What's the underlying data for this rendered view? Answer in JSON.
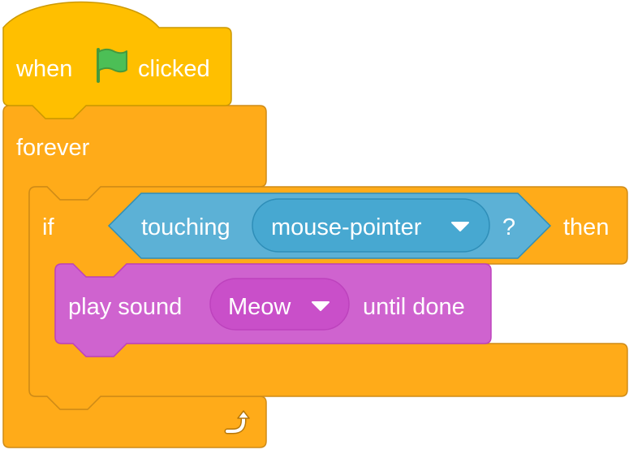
{
  "script": {
    "hat": {
      "word_before": "when",
      "icon": "green-flag-icon",
      "word_after": "clicked",
      "color": "#FFBF00"
    },
    "forever": {
      "label": "forever",
      "loop_icon": "loop-arrow-icon",
      "color": "#FFAB19"
    },
    "if_block": {
      "if_label": "if",
      "then_label": "then",
      "color": "#FFAB19"
    },
    "condition": {
      "label": "touching",
      "target": "mouse-pointer",
      "question": "?",
      "color": "#5CB1D6",
      "menu_color": "#47A8D1"
    },
    "sound_block": {
      "label_before": "play sound",
      "sound": "Meow",
      "label_after": "until done",
      "color": "#CF63CF",
      "menu_color": "#C94FC9"
    }
  }
}
